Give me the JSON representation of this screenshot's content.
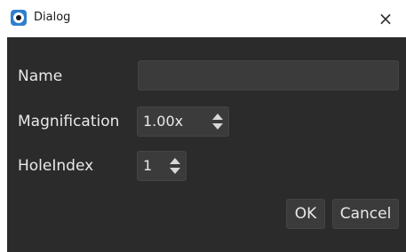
{
  "window": {
    "title": "Dialog",
    "close_glyph": "×"
  },
  "form": {
    "name_label": "Name",
    "name_value": "",
    "magnification_label": "Magnification",
    "magnification_value": "1.00x",
    "hole_index_label": "HoleIndex",
    "hole_index_value": "1"
  },
  "buttons": {
    "ok_label": "OK",
    "cancel_label": "Cancel"
  },
  "colors": {
    "content_background": "#2b2b2b",
    "field_background": "#3b3b3b",
    "text": "#e9e9e9",
    "app_icon_accent": "#2f7fcf"
  },
  "icons": {
    "app": "app-eye-icon",
    "close": "close-icon",
    "spin_up": "chevron-up-icon",
    "spin_down": "chevron-down-icon"
  }
}
